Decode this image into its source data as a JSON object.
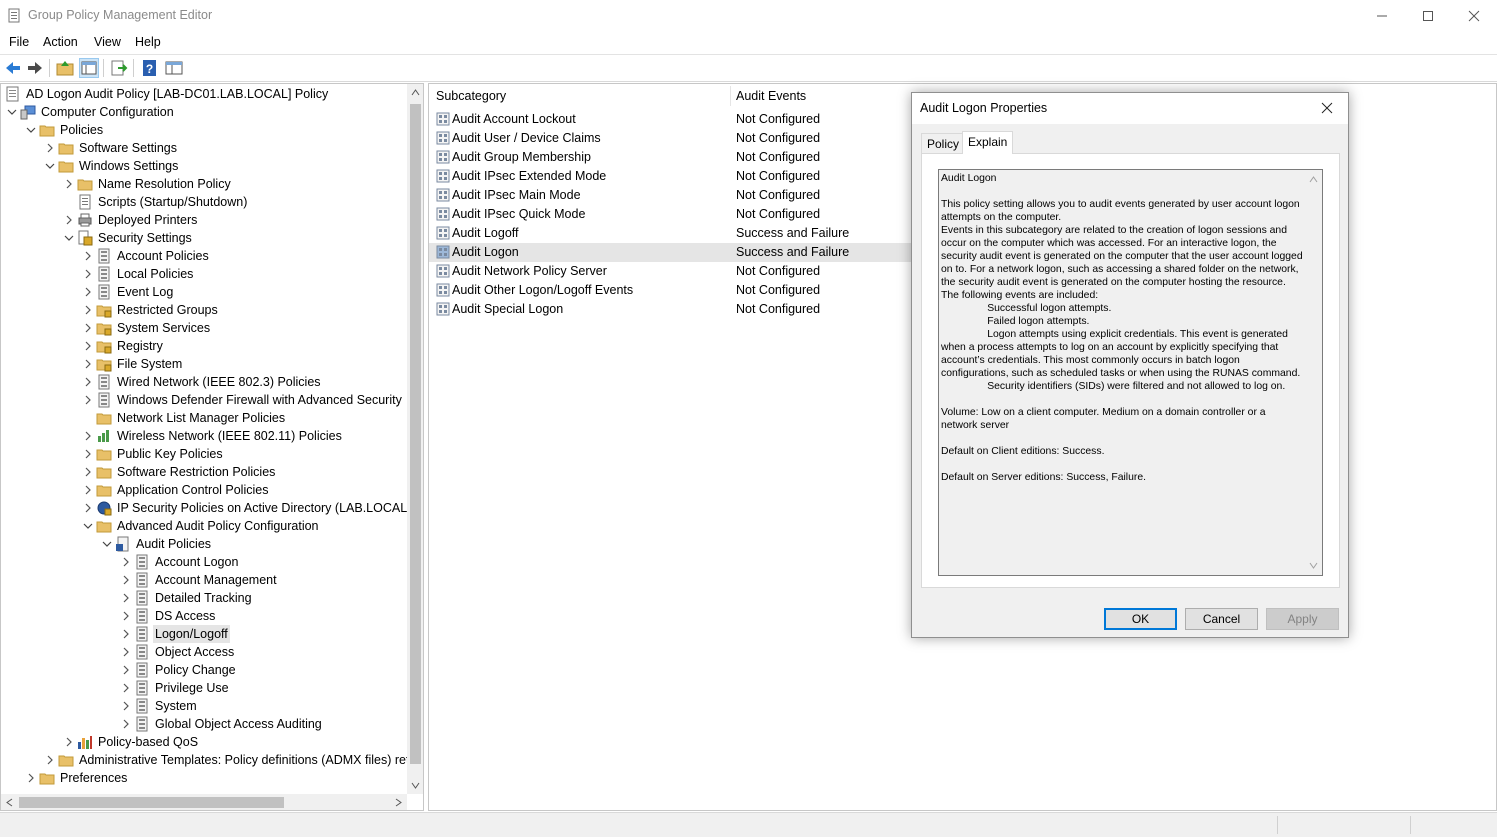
{
  "window": {
    "title": "Group Policy Management Editor"
  },
  "menu": [
    "File",
    "Action",
    "View",
    "Help"
  ],
  "tree": {
    "root_label": "AD Logon Audit Policy [LAB-DC01.LAB.LOCAL] Policy",
    "items": [
      {
        "label": "Computer Configuration",
        "level": 0,
        "expander": "open",
        "icon": "computer-icon"
      },
      {
        "label": "Policies",
        "level": 1,
        "expander": "open",
        "icon": "folder-icon"
      },
      {
        "label": "Software Settings",
        "level": 2,
        "expander": "closed",
        "icon": "folder-icon"
      },
      {
        "label": "Windows Settings",
        "level": 2,
        "expander": "open",
        "icon": "folder-icon"
      },
      {
        "label": "Name Resolution Policy",
        "level": 3,
        "expander": "closed",
        "icon": "folder-icon"
      },
      {
        "label": "Scripts (Startup/Shutdown)",
        "level": 3,
        "expander": "none",
        "icon": "scripts-icon"
      },
      {
        "label": "Deployed Printers",
        "level": 3,
        "expander": "closed",
        "icon": "printer-icon"
      },
      {
        "label": "Security Settings",
        "level": 3,
        "expander": "open",
        "icon": "security-settings-icon"
      },
      {
        "label": "Account Policies",
        "level": 4,
        "expander": "closed",
        "icon": "policy-book-icon"
      },
      {
        "label": "Local Policies",
        "level": 4,
        "expander": "closed",
        "icon": "policy-book-icon"
      },
      {
        "label": "Event Log",
        "level": 4,
        "expander": "closed",
        "icon": "policy-book-icon"
      },
      {
        "label": "Restricted Groups",
        "level": 4,
        "expander": "closed",
        "icon": "locked-folder-icon"
      },
      {
        "label": "System Services",
        "level": 4,
        "expander": "closed",
        "icon": "locked-folder-icon"
      },
      {
        "label": "Registry",
        "level": 4,
        "expander": "closed",
        "icon": "locked-folder-icon"
      },
      {
        "label": "File System",
        "level": 4,
        "expander": "closed",
        "icon": "locked-folder-icon"
      },
      {
        "label": "Wired Network (IEEE 802.3) Policies",
        "level": 4,
        "expander": "closed",
        "icon": "policy-book-icon"
      },
      {
        "label": "Windows Defender Firewall with Advanced Security",
        "level": 4,
        "expander": "closed",
        "icon": "policy-book-icon"
      },
      {
        "label": "Network List Manager Policies",
        "level": 4,
        "expander": "none",
        "icon": "folder-icon"
      },
      {
        "label": "Wireless Network (IEEE 802.11) Policies",
        "level": 4,
        "expander": "closed",
        "icon": "wireless-icon"
      },
      {
        "label": "Public Key Policies",
        "level": 4,
        "expander": "closed",
        "icon": "folder-icon"
      },
      {
        "label": "Software Restriction Policies",
        "level": 4,
        "expander": "closed",
        "icon": "folder-icon"
      },
      {
        "label": "Application Control Policies",
        "level": 4,
        "expander": "closed",
        "icon": "folder-icon"
      },
      {
        "label": "IP Security Policies on Active Directory (LAB.LOCAL)",
        "level": 4,
        "expander": "closed",
        "icon": "ip-security-icon"
      },
      {
        "label": "Advanced Audit Policy Configuration",
        "level": 4,
        "expander": "open",
        "icon": "folder-icon"
      },
      {
        "label": "Audit Policies",
        "level": 5,
        "expander": "open",
        "icon": "audit-policies-icon"
      },
      {
        "label": "Account Logon",
        "level": 6,
        "expander": "closed",
        "icon": "policy-book-icon"
      },
      {
        "label": "Account Management",
        "level": 6,
        "expander": "closed",
        "icon": "policy-book-icon"
      },
      {
        "label": "Detailed Tracking",
        "level": 6,
        "expander": "closed",
        "icon": "policy-book-icon"
      },
      {
        "label": "DS Access",
        "level": 6,
        "expander": "closed",
        "icon": "policy-book-icon"
      },
      {
        "label": "Logon/Logoff",
        "level": 6,
        "expander": "closed",
        "icon": "policy-book-icon",
        "selected": true
      },
      {
        "label": "Object Access",
        "level": 6,
        "expander": "closed",
        "icon": "policy-book-icon"
      },
      {
        "label": "Policy Change",
        "level": 6,
        "expander": "closed",
        "icon": "policy-book-icon"
      },
      {
        "label": "Privilege Use",
        "level": 6,
        "expander": "closed",
        "icon": "policy-book-icon"
      },
      {
        "label": "System",
        "level": 6,
        "expander": "closed",
        "icon": "policy-book-icon"
      },
      {
        "label": "Global Object Access Auditing",
        "level": 6,
        "expander": "closed",
        "icon": "policy-book-icon"
      },
      {
        "label": "Policy-based QoS",
        "level": 3,
        "expander": "closed",
        "icon": "qos-chart-icon"
      },
      {
        "label": "Administrative Templates: Policy definitions (ADMX files) retri",
        "level": 2,
        "expander": "closed",
        "icon": "folder-icon"
      },
      {
        "label": "Preferences",
        "level": 1,
        "expander": "closed",
        "icon": "folder-icon"
      }
    ]
  },
  "list": {
    "columns": [
      "Subcategory",
      "Audit Events"
    ],
    "rows": [
      {
        "subcategory": "Audit Account Lockout",
        "events": "Not Configured"
      },
      {
        "subcategory": "Audit User / Device Claims",
        "events": "Not Configured"
      },
      {
        "subcategory": "Audit Group Membership",
        "events": "Not Configured"
      },
      {
        "subcategory": "Audit IPsec Extended Mode",
        "events": "Not Configured"
      },
      {
        "subcategory": "Audit IPsec Main Mode",
        "events": "Not Configured"
      },
      {
        "subcategory": "Audit IPsec Quick Mode",
        "events": "Not Configured"
      },
      {
        "subcategory": "Audit Logoff",
        "events": "Success and Failure"
      },
      {
        "subcategory": "Audit Logon",
        "events": "Success and Failure",
        "selected": true
      },
      {
        "subcategory": "Audit Network Policy Server",
        "events": "Not Configured"
      },
      {
        "subcategory": "Audit Other Logon/Logoff Events",
        "events": "Not Configured"
      },
      {
        "subcategory": "Audit Special Logon",
        "events": "Not Configured"
      }
    ]
  },
  "dialog": {
    "title": "Audit Logon Properties",
    "tabs": [
      "Policy",
      "Explain"
    ],
    "active_tab": "Explain",
    "explain_text": "Audit Logon\n\nThis policy setting allows you to audit events generated by user account logon attempts on the computer.\nEvents in this subcategory are related to the creation of logon sessions and occur on the computer which was accessed. For an interactive logon, the security audit event is generated on the computer that the user account logged on to. For a network logon, such as accessing a shared folder on the network, the security audit event is generated on the computer hosting the resource. The following events are included:\n\t\tSuccessful logon attempts.\n\t\tFailed logon attempts.\n\t\tLogon attempts using explicit credentials. This event is generated when a process attempts to log on an account by explicitly specifying that account’s credentials. This most commonly occurs in batch logon configurations, such as scheduled tasks or when using the RUNAS command.\n\t\tSecurity identifiers (SIDs) were filtered and not allowed to log on.\n\nVolume: Low on a client computer. Medium on a domain controller or a network server\n\nDefault on Client editions: Success.\n\nDefault on Server editions: Success, Failure.",
    "buttons": {
      "ok": "OK",
      "cancel": "Cancel",
      "apply": "Apply"
    }
  },
  "colors": {
    "folder": "#e8c068",
    "accent": "#0078d7",
    "selection": "#e5e5e5"
  }
}
